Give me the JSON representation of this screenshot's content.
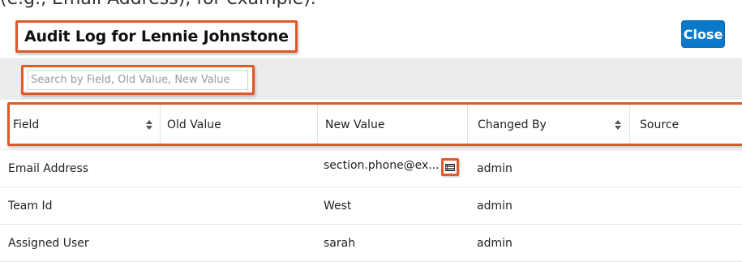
{
  "page": {
    "cut_text": "(e.g., Email Address), for example)."
  },
  "header": {
    "title": "Audit Log for Lennie Johnstone",
    "close_label": "Close"
  },
  "search": {
    "placeholder": "Search by Field, Old Value, New Value"
  },
  "table": {
    "columns": [
      "Field",
      "Old Value",
      "New Value",
      "Changed By",
      "Source"
    ],
    "rows": [
      {
        "field": "Email Address",
        "old_value": "",
        "new_value": "section.phone@ex...",
        "changed_by": "admin",
        "source": ""
      },
      {
        "field": "Team Id",
        "old_value": "",
        "new_value": "West",
        "changed_by": "admin",
        "source": ""
      },
      {
        "field": "Assigned User",
        "old_value": "",
        "new_value": "sarah",
        "changed_by": "admin",
        "source": ""
      }
    ]
  },
  "colors": {
    "highlight": "#e0592a",
    "primary_button": "#0a79c9",
    "search_bar_bg": "#ececec"
  }
}
